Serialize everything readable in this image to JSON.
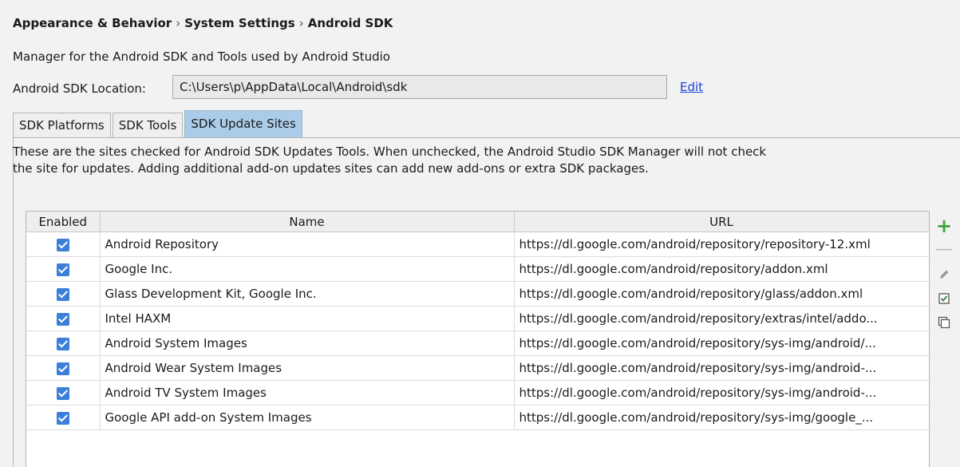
{
  "breadcrumb": {
    "item1": "Appearance & Behavior",
    "item2": "System Settings",
    "item3": "Android SDK",
    "separator": "›"
  },
  "description": "Manager for the Android SDK and Tools used by Android Studio",
  "sdk_location": {
    "label": "Android SDK Location:",
    "value": "C:\\Users\\p\\AppData\\Local\\Android\\sdk",
    "edit_label": "Edit"
  },
  "tabs": [
    {
      "label": "SDK Platforms"
    },
    {
      "label": "SDK Tools"
    },
    {
      "label": "SDK Update Sites"
    }
  ],
  "panel_text": "These are the sites checked for Android SDK Updates Tools. When unchecked, the Android Studio SDK Manager will not check the site for updates. Adding additional add-on updates sites can add new add-ons or extra SDK packages.",
  "table": {
    "headers": {
      "enabled": "Enabled",
      "name": "Name",
      "url": "URL"
    },
    "rows": [
      {
        "enabled": true,
        "name": "Android Repository",
        "url": "https://dl.google.com/android/repository/repository-12.xml"
      },
      {
        "enabled": true,
        "name": "Google Inc.",
        "url": "https://dl.google.com/android/repository/addon.xml"
      },
      {
        "enabled": true,
        "name": "Glass Development Kit, Google Inc.",
        "url": "https://dl.google.com/android/repository/glass/addon.xml"
      },
      {
        "enabled": true,
        "name": "Intel HAXM",
        "url": "https://dl.google.com/android/repository/extras/intel/addo..."
      },
      {
        "enabled": true,
        "name": "Android System Images",
        "url": "https://dl.google.com/android/repository/sys-img/android/..."
      },
      {
        "enabled": true,
        "name": "Android Wear System Images",
        "url": "https://dl.google.com/android/repository/sys-img/android-..."
      },
      {
        "enabled": true,
        "name": "Android TV System Images",
        "url": "https://dl.google.com/android/repository/sys-img/android-..."
      },
      {
        "enabled": true,
        "name": "Google API add-on System Images",
        "url": "https://dl.google.com/android/repository/sys-img/google_..."
      }
    ]
  },
  "side_tools": [
    {
      "icon": "plus-icon",
      "color": "#3aa53a"
    },
    {
      "icon": "minus-icon",
      "color": "#bdbdbd"
    },
    {
      "icon": "pencil-icon",
      "color": "#9a9a9a"
    },
    {
      "icon": "select-all-icon",
      "color": "#3a7a3a"
    },
    {
      "icon": "deselect-all-icon",
      "color": "#555555"
    }
  ],
  "colors": {
    "active_tab": "#aacce8",
    "checkbox": "#3b7fd9",
    "link": "#1a3fd6"
  }
}
